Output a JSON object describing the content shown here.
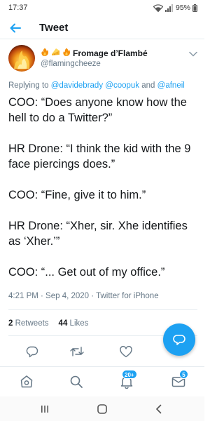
{
  "status_bar": {
    "time": "17:37",
    "battery": "95%"
  },
  "header": {
    "title": "Tweet"
  },
  "author": {
    "display_name": "Fromage d’Flambé",
    "handle": "@flamingcheeze",
    "name_emojis": [
      "fire-emoji",
      "cheese-emoji",
      "fire-emoji"
    ]
  },
  "reply": {
    "prefix": "Replying to",
    "mentions": [
      "@davidebrady",
      "@coopuk",
      "@afneil"
    ],
    "conjunction": "and"
  },
  "tweet": {
    "paragraphs": [
      "COO: “Does anyone know how the hell to do a Twitter?”",
      "HR Drone: “I think the kid with the 9 face piercings does.”",
      "COO: “Fine, give it to him.”",
      "HR Drone: “Xher, sir. Xhe identifies as ‘Xher.’”",
      "COO: “... Get out of my office.”"
    ],
    "timestamp": "4:21 PM · Sep 4, 2020",
    "source": "Twitter for iPhone"
  },
  "stats": {
    "retweets_count": "2",
    "retweets_label": "Retweets",
    "likes_count": "44",
    "likes_label": "Likes"
  },
  "actions": {
    "icons": [
      "reply-icon",
      "retweet-icon",
      "like-icon",
      "share-icon"
    ]
  },
  "bottom_nav": {
    "notifications_badge": "20+",
    "messages_badge": "5"
  },
  "colors": {
    "accent": "#1da1f2",
    "text": "#14171a",
    "muted": "#657786",
    "divider": "#e6ecf0"
  }
}
